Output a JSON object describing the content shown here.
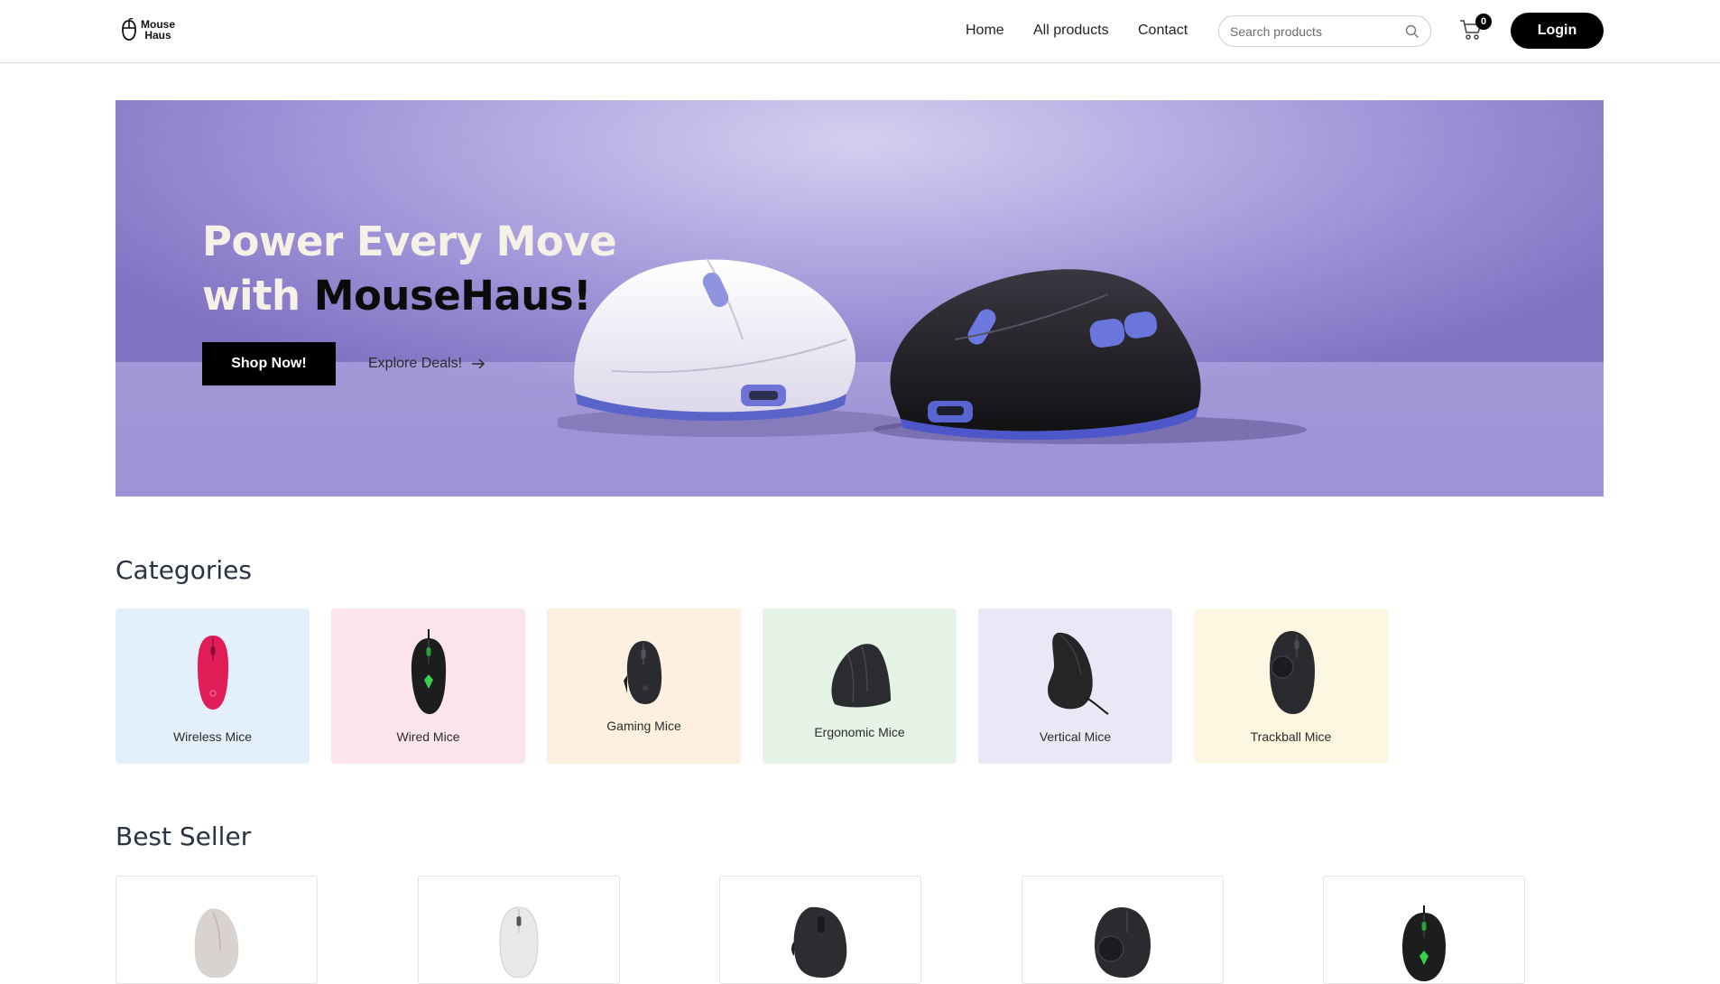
{
  "header": {
    "logo_text_line1": "Mouse",
    "logo_text_line2": "Haus",
    "nav": [
      {
        "label": "Home"
      },
      {
        "label": "All products"
      },
      {
        "label": "Contact"
      }
    ],
    "search_placeholder": "Search products",
    "cart_count": "0",
    "login_label": "Login"
  },
  "hero": {
    "title_line1": "Power Every Move",
    "title_line2_prefix": "with ",
    "title_brand": "MouseHaus!",
    "shop_button": "Shop Now!",
    "explore_link": "Explore Deals!"
  },
  "categories": {
    "title": "Categories",
    "items": [
      {
        "label": "Wireless Mice",
        "bg": "#e3effb",
        "icon": "pink-wireless-mouse"
      },
      {
        "label": "Wired Mice",
        "bg": "#fbe4ec",
        "icon": "razer-wired-mouse"
      },
      {
        "label": "Gaming Mice",
        "bg": "#fdf0e0",
        "icon": "gaming-mouse"
      },
      {
        "label": "Ergonomic Mice",
        "bg": "#e5f3e7",
        "icon": "ergonomic-mouse"
      },
      {
        "label": "Vertical Mice",
        "bg": "#ece7f6",
        "icon": "vertical-mouse"
      },
      {
        "label": "Trackball Mice",
        "bg": "#fdf6e0",
        "icon": "trackball-mouse"
      }
    ]
  },
  "best_seller": {
    "title": "Best Seller",
    "products": [
      {
        "icon": "beige-ergonomic-mouse"
      },
      {
        "icon": "white-wireless-mouse"
      },
      {
        "icon": "black-mx-mouse"
      },
      {
        "icon": "black-trackball-mouse"
      },
      {
        "icon": "razer-deathadder-mouse"
      }
    ]
  },
  "colors": {
    "accent": "#000000",
    "hero_bg": "#a79fdc",
    "hero_text": "#f6f1e6"
  }
}
